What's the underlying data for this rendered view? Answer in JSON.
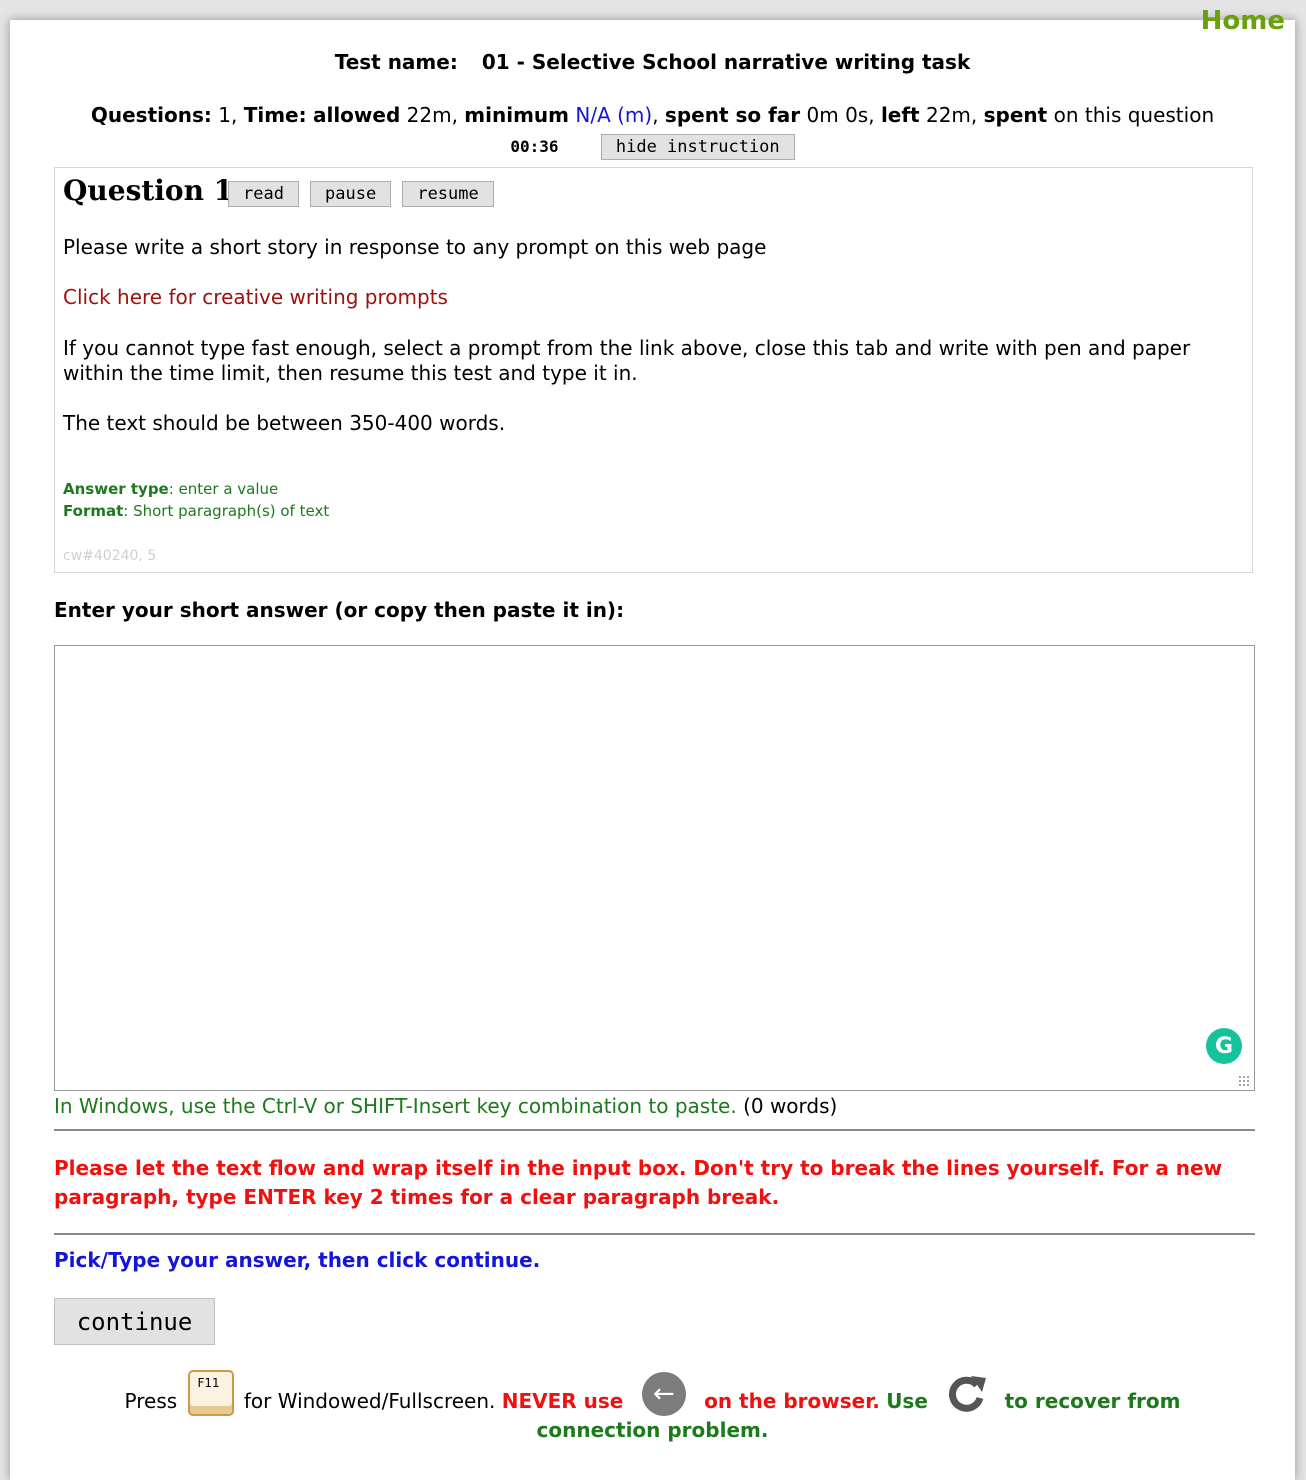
{
  "nav": {
    "home": "Home"
  },
  "test": {
    "label": "Test name:",
    "name": "01 - Selective School narrative writing task"
  },
  "info": {
    "questions_label": "Questions:",
    "questions_value": "1",
    "time_label": "Time:",
    "allowed_label": "allowed",
    "allowed_value": "22m",
    "minimum_label": "minimum",
    "minimum_value": "N/A (m)",
    "spent_label": "spent so far",
    "spent_value": "0m 0s",
    "left_label": "left",
    "left_value": "22m",
    "spent_on_label": "spent",
    "spent_on_suffix": "on this question",
    "timer": "00:36",
    "hide_button": "hide instruction"
  },
  "question": {
    "title": "Question 1",
    "buttons": {
      "read": "read",
      "pause": "pause",
      "resume": "resume"
    },
    "paragraph1": "Please write a short story in response to any prompt on this web page",
    "link": "Click here for creative writing prompts",
    "paragraph2": "If you cannot type fast enough, select a prompt from the link above, close this tab and write with pen and paper within the time limit, then resume this test and type it in.",
    "paragraph3": "The text should be between 350-400 words.",
    "answer_type_label": "Answer type",
    "answer_type_value": ": enter a value",
    "format_label": "Format",
    "format_value": ": Short paragraph(s) of text",
    "id": "cw#40240, 5"
  },
  "answer": {
    "label": "Enter your short answer (or copy then paste it in):",
    "value": "",
    "grammarly": "G",
    "paste_hint": "In Windows, use the Ctrl-V or SHIFT-Insert key combination to paste.",
    "word_count": "(0 words)"
  },
  "warning": "Please let the text flow and wrap itself in the input box. Don't try to break the lines yourself. For a new paragraph, type ENTER key 2 times for a clear paragraph break.",
  "pick": "Pick/Type your answer, then click continue.",
  "continue_button": "continue",
  "footer": {
    "press": "Press",
    "key": "F11",
    "fullscreen": "for Windowed/Fullscreen.",
    "never": "NEVER use",
    "on_browser": "on the browser.",
    "use": "Use",
    "recover": "to recover from connection problem."
  },
  "colors": {
    "link": "#a01010",
    "info_blue": "#1515d8",
    "hint_green": "#1c7a1c",
    "warning_red": "#f01010",
    "home_green": "#6aa10a"
  }
}
